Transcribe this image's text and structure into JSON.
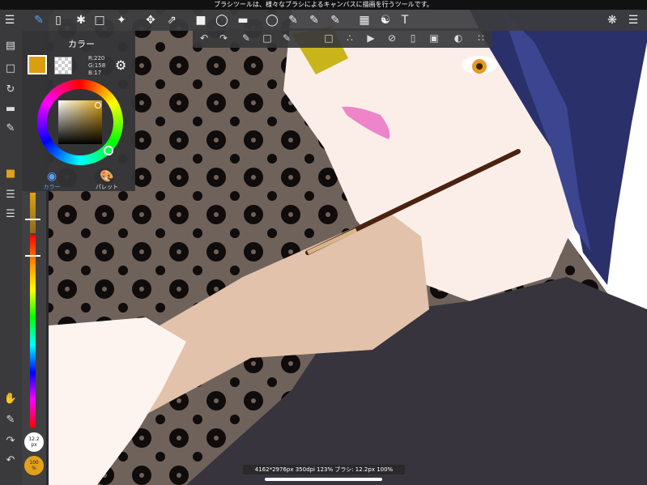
{
  "notice": "ブラシツールは、様々なブラシによるキャンバスに描画を行うツールです。",
  "color_panel": {
    "title": "カラー",
    "r_label": "R:220",
    "g_label": "G:158",
    "b_label": "B:17",
    "tabs": [
      "カラー",
      "パレット"
    ],
    "foreground_color": "#dc9e11"
  },
  "brush_size": {
    "value": "12.2",
    "unit": "px"
  },
  "opacity": {
    "value": "100",
    "unit": "%"
  },
  "status_bar": "4162*2976px 350dpi 123% ブラシ: 12.2px 100%",
  "icons": {
    "top_toolbar": [
      "menu-icon",
      "brush-icon",
      "eraser-icon",
      "blur-icon",
      "rect-select-icon",
      "magic-wand-icon",
      "move-icon",
      "transform-icon",
      "fill-rect-icon",
      "bucket-icon",
      "gradient-icon",
      "lasso-icon",
      "select-pen-icon",
      "select-eraser-icon",
      "select-edit-icon",
      "frame-icon",
      "balloon-icon",
      "text-icon",
      "materials-icon",
      "layers-icon"
    ],
    "left_toolbar": [
      "pages-icon",
      "select-icon",
      "rotate-icon",
      "ruler-icon",
      "pen-icon",
      "color-swatch-icon",
      "brush-list-icon",
      "layer-icon",
      "hand-icon",
      "eyedropper-icon",
      "redo-icon",
      "undo-icon"
    ]
  }
}
